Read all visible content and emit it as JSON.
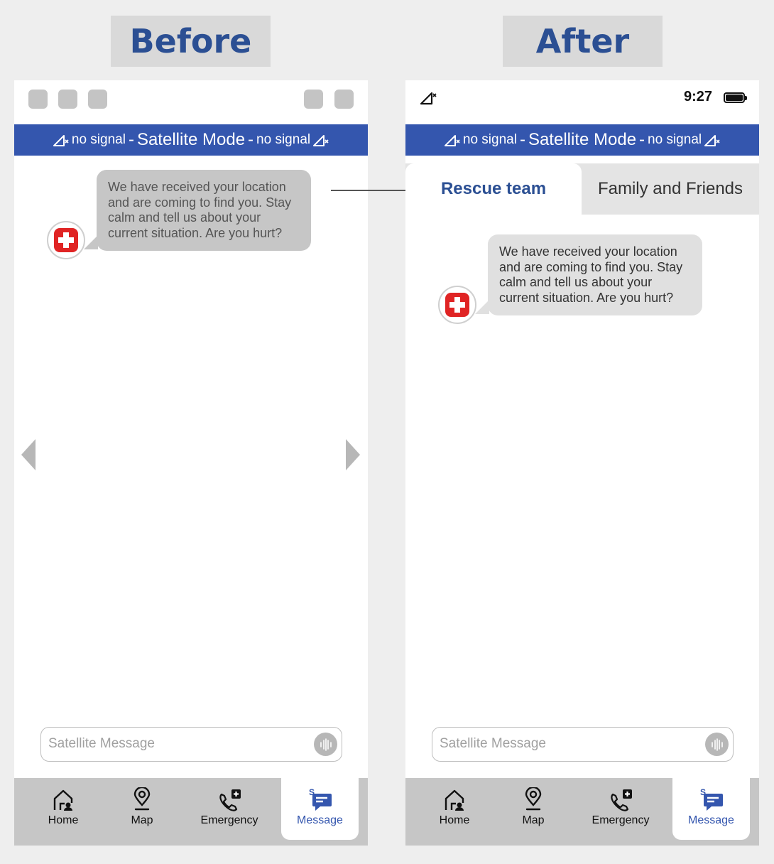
{
  "labels": {
    "before": "Before",
    "after": "After"
  },
  "satellite_bar": {
    "left": "no signal",
    "sep1": "-",
    "mode": "Satellite Mode",
    "sep2": "-",
    "right": "no signal"
  },
  "status_bar": {
    "time": "9:27"
  },
  "tabs": [
    {
      "label": "Rescue team",
      "selected": true
    },
    {
      "label": "Family and Friends",
      "selected": false
    }
  ],
  "message": {
    "before_text": "We have received your location and are coming to find you. Stay calm and tell us about your current situation. Are you hurt?",
    "after_text": "We have received your location and are coming to find you. Stay calm and tell us about your current situation. Are you hurt?"
  },
  "input": {
    "placeholder": "Satellite Message"
  },
  "nav": {
    "home": "Home",
    "map": "Map",
    "emergency": "Emergency",
    "message": "Message",
    "active": "Message"
  },
  "colors": {
    "brand_blue": "#3456ae",
    "label_blue": "#2b4f93",
    "rescue_red": "#e02424"
  },
  "icons": [
    "signal-off-icon",
    "battery-icon",
    "rescue-cross-icon",
    "microphone-icon",
    "home-icon",
    "map-pin-icon",
    "emergency-call-icon",
    "satellite-message-icon",
    "chevron-left-icon",
    "chevron-right-icon",
    "arrow-icon"
  ]
}
